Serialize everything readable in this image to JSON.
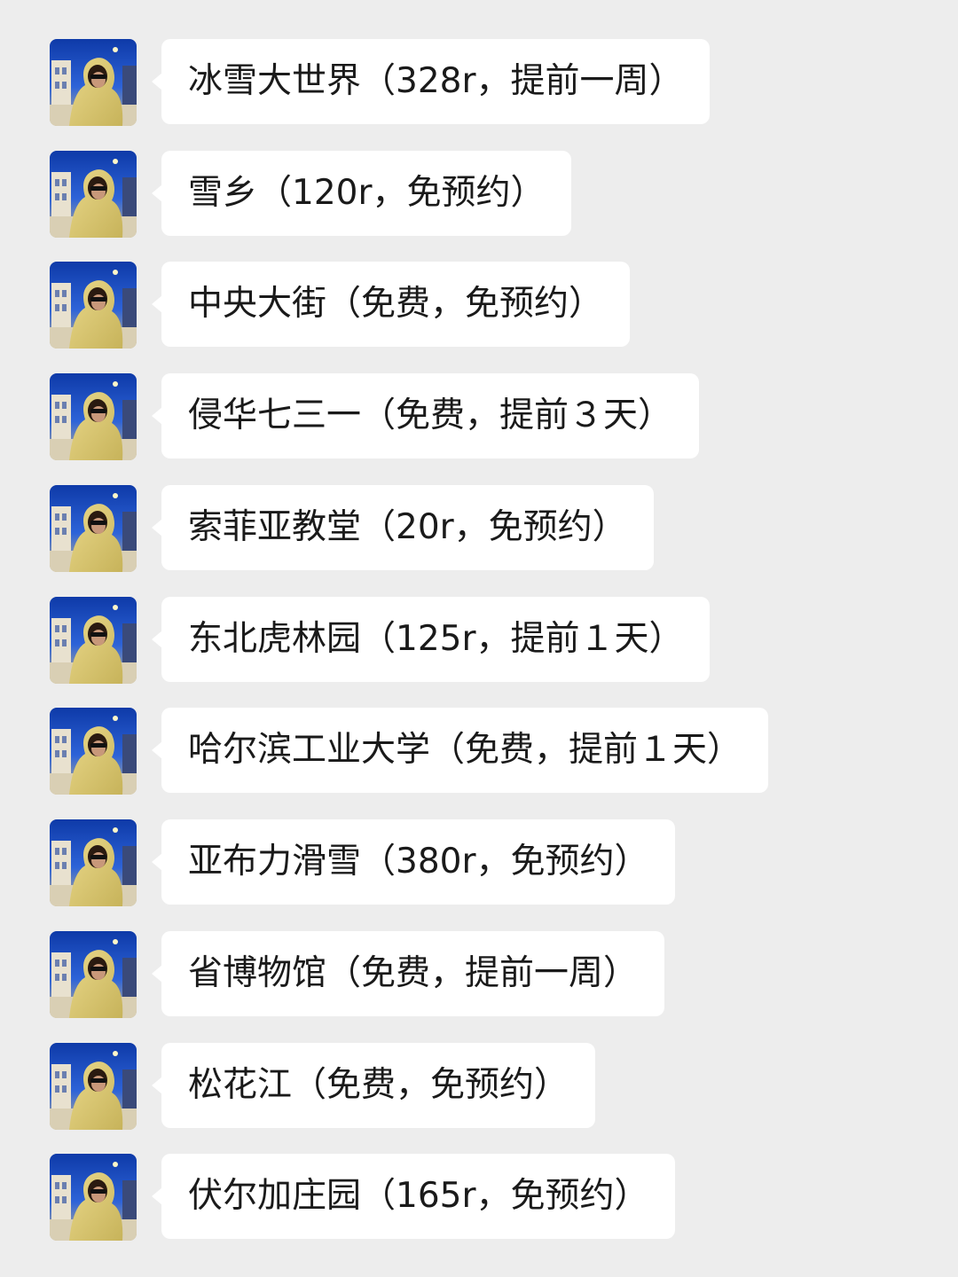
{
  "messages": [
    {
      "text": "冰雪大世界（328r，提前一周）"
    },
    {
      "text": "雪乡（120r，免预约）"
    },
    {
      "text": "中央大街（免费，免预约）"
    },
    {
      "text": "侵华七三一（免费，提前３天）"
    },
    {
      "text": "索菲亚教堂（20r，免预约）"
    },
    {
      "text": "东北虎林园（125r，提前１天）"
    },
    {
      "text": "哈尔滨工业大学（免费，提前１天）"
    },
    {
      "text": "亚布力滑雪（380r，免预约）"
    },
    {
      "text": "省博物馆（免费，提前一周）"
    },
    {
      "text": "松花江（免费，免预约）"
    },
    {
      "text": "伏尔加庄园（165r，免预约）"
    }
  ],
  "theme": {
    "background": "#ededed",
    "bubble": "#ffffff",
    "text": "#1a1a1a"
  }
}
